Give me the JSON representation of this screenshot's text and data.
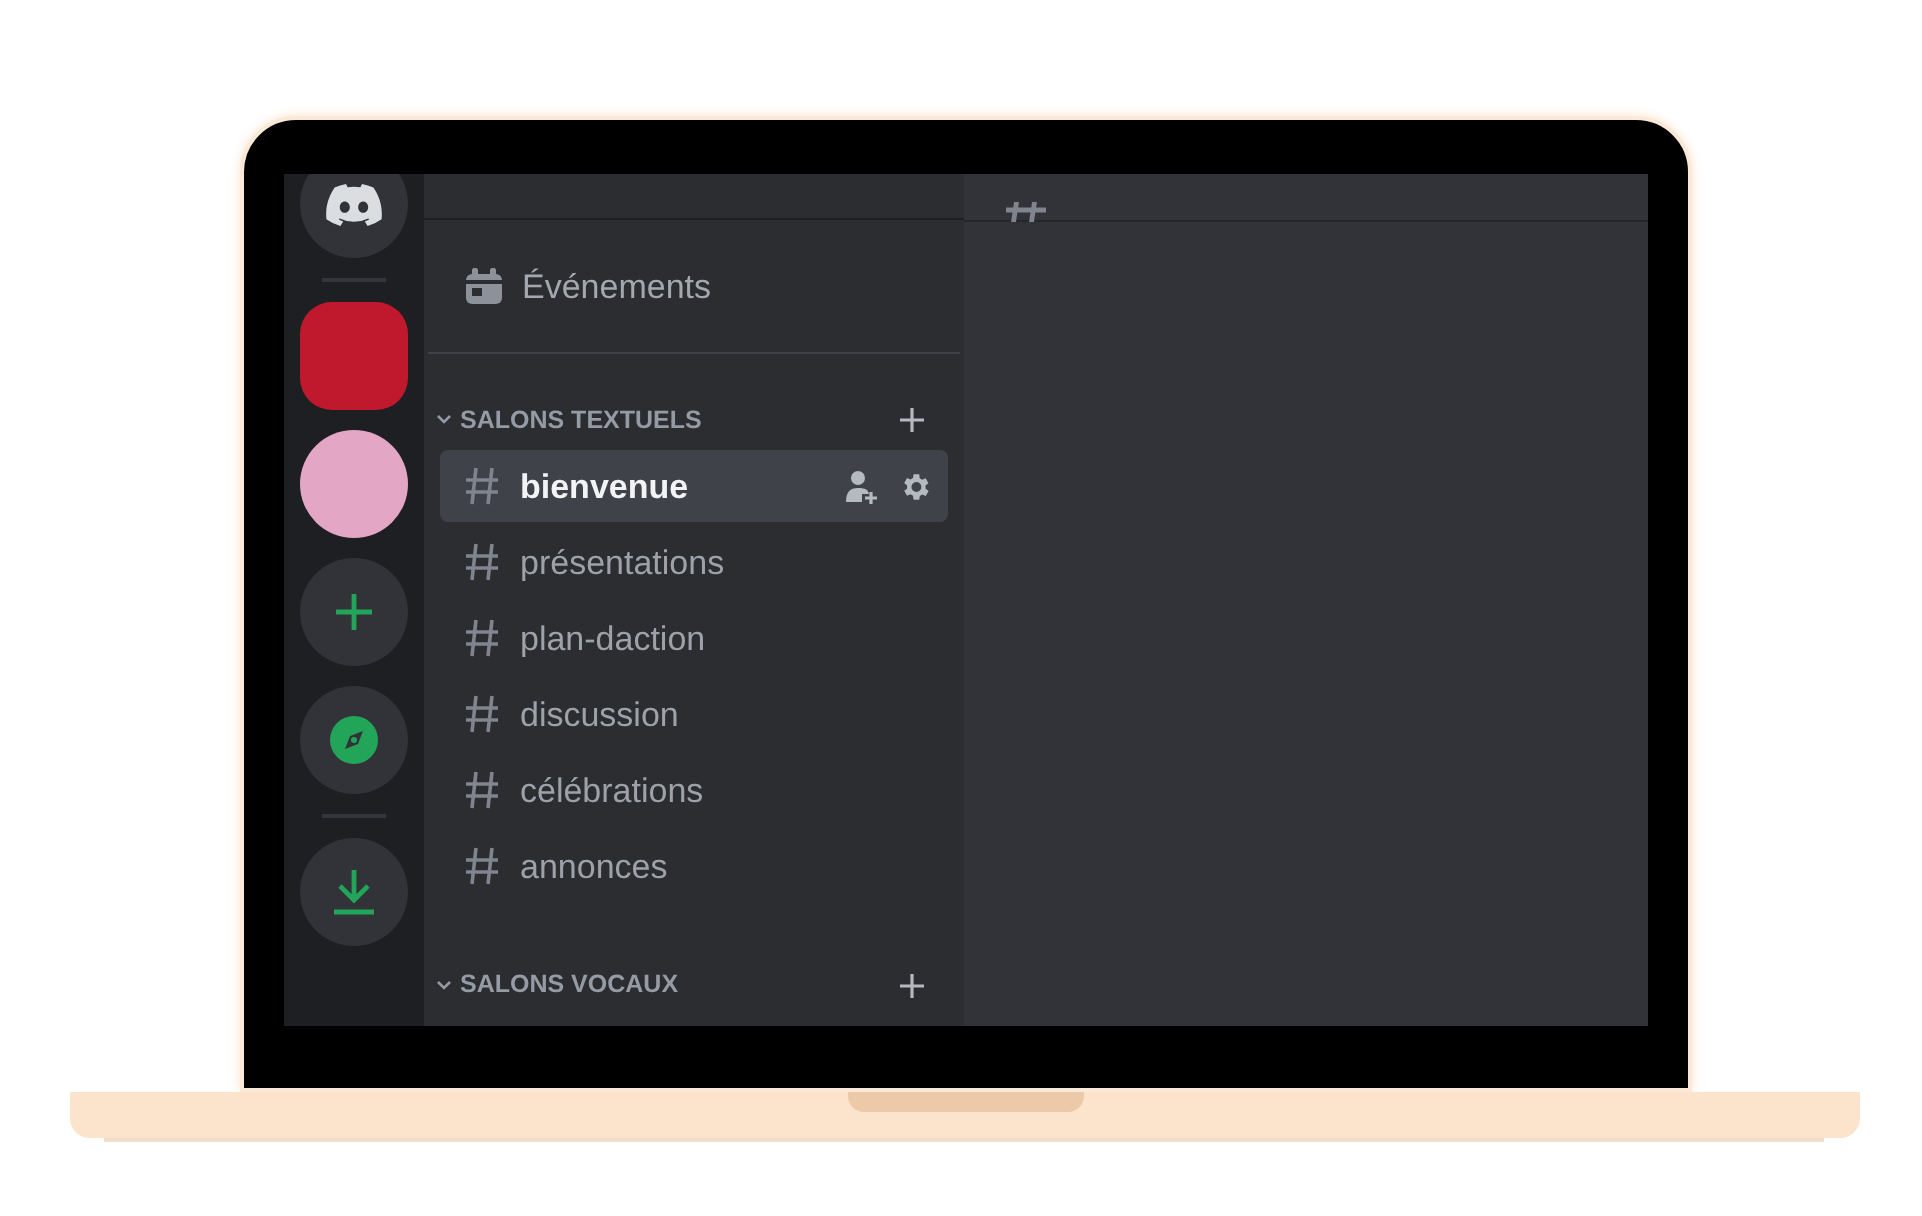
{
  "servers": [
    {
      "kind": "home",
      "selected": false
    },
    {
      "kind": "photo",
      "selected": true,
      "color": "#c0182c"
    },
    {
      "kind": "photo",
      "selected": false,
      "color": "#e3a6c4"
    },
    {
      "kind": "add",
      "selected": false
    },
    {
      "kind": "explore",
      "selected": false
    },
    {
      "kind": "download",
      "selected": false
    }
  ],
  "events": {
    "label": "Événements"
  },
  "categories": [
    {
      "label": "SALONS TEXTUELS",
      "expanded": true,
      "channels": [
        {
          "name": "bienvenue",
          "selected": true
        },
        {
          "name": "présentations",
          "selected": false
        },
        {
          "name": "plan-daction",
          "selected": false
        },
        {
          "name": "discussion",
          "selected": false
        },
        {
          "name": "célébrations",
          "selected": false
        },
        {
          "name": "annonces",
          "selected": false
        }
      ]
    },
    {
      "label": "SALONS VOCAUX",
      "expanded": true
    }
  ]
}
